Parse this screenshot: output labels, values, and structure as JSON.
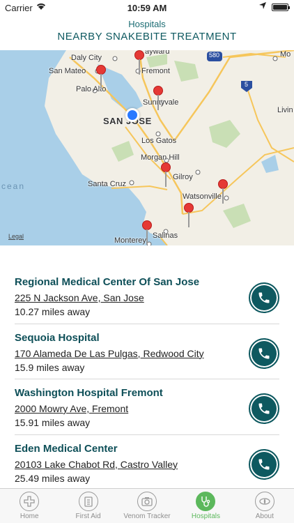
{
  "status_bar": {
    "carrier": "Carrier",
    "time": "10:59 AM"
  },
  "header": {
    "section": "Hospitals",
    "title": "NEARBY SNAKEBITE TREATMENT"
  },
  "map": {
    "labels": {
      "daly_city": "Daly City",
      "fremont": "Fremont",
      "san_mateo": "San Mateo",
      "palo_alto": "Palo Alto",
      "sunnyvale": "Sunnyvale",
      "san_jose": "SAN JOSE",
      "los_gatos": "Los Gatos",
      "morgan_hill": "Morgan Hill",
      "gilroy": "Gilroy",
      "santa_cruz": "Santa Cruz",
      "watsonville": "Watsonville",
      "salinas": "Salinas",
      "monterey": "Monterey",
      "livin": "Livin",
      "mo": "Mo",
      "ocean": "cean",
      "hayward": "ayward",
      "i580": "580",
      "i5": "5"
    },
    "legal": "Legal",
    "colors": {
      "water": "#a9cfe8",
      "land": "#f2efe6",
      "road": "#f6c65b",
      "pin": "#e53935",
      "location": "#2979ff"
    }
  },
  "hospitals": [
    {
      "name": "Regional Medical Center Of San Jose",
      "address": "225 N Jackson Ave, San Jose",
      "distance": "10.27 miles away"
    },
    {
      "name": "Sequoia Hospital",
      "address": "170 Alameda De Las Pulgas, Redwood City",
      "distance": "15.9 miles away"
    },
    {
      "name": "Washington Hospital Fremont",
      "address": "2000 Mowry Ave, Fremont",
      "distance": "15.91 miles away"
    },
    {
      "name": "Eden Medical Center",
      "address": "20103 Lake Chabot Rd, Castro Valley",
      "distance": "25.49 miles away"
    }
  ],
  "tabs": [
    {
      "label": "Home",
      "icon": "plus-circle-icon"
    },
    {
      "label": "First Aid",
      "icon": "clipboard-icon"
    },
    {
      "label": "Venom Tracker",
      "icon": "camera-icon"
    },
    {
      "label": "Hospitals",
      "icon": "stethoscope-icon",
      "active": true
    },
    {
      "label": "About",
      "icon": "snake-eye-icon"
    }
  ],
  "theme": {
    "accent": "#0e5960",
    "active_tab": "#5cb85c"
  }
}
